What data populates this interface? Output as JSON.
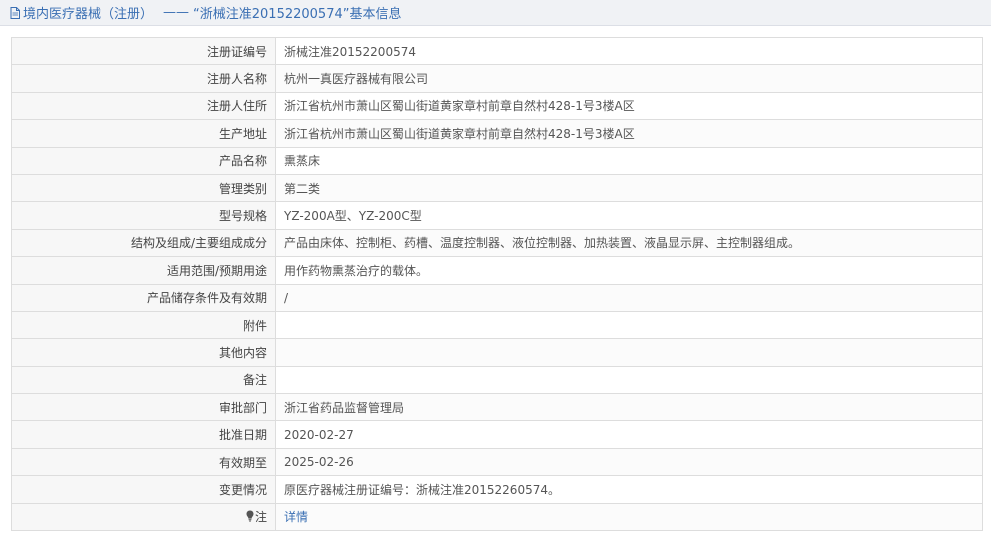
{
  "header": {
    "icon": "document-icon",
    "category": "境内医疗器械（注册）",
    "separator": "——",
    "title": "“浙械注准20152200574”基本信息"
  },
  "rows": [
    {
      "label": "注册证编号",
      "value": "浙械注准20152200574"
    },
    {
      "label": "注册人名称",
      "value": "杭州一真医疗器械有限公司"
    },
    {
      "label": "注册人住所",
      "value": "浙江省杭州市萧山区蜀山街道黄家章村前章自然村428-1号3楼A区"
    },
    {
      "label": "生产地址",
      "value": "浙江省杭州市萧山区蜀山街道黄家章村前章自然村428-1号3楼A区"
    },
    {
      "label": "产品名称",
      "value": "熏蒸床"
    },
    {
      "label": "管理类别",
      "value": "第二类"
    },
    {
      "label": "型号规格",
      "value": "YZ-200A型、YZ-200C型"
    },
    {
      "label": "结构及组成/主要组成成分",
      "value": "产品由床体、控制柜、药槽、温度控制器、液位控制器、加热装置、液晶显示屏、主控制器组成。"
    },
    {
      "label": "适用范围/预期用途",
      "value": "用作药物熏蒸治疗的载体。"
    },
    {
      "label": "产品储存条件及有效期",
      "value": "/"
    },
    {
      "label": "附件",
      "value": ""
    },
    {
      "label": "其他内容",
      "value": ""
    },
    {
      "label": "备注",
      "value": ""
    },
    {
      "label": "审批部门",
      "value": "浙江省药品监督管理局"
    },
    {
      "label": "批准日期",
      "value": "2020-02-27"
    },
    {
      "label": "有效期至",
      "value": "2025-02-26"
    },
    {
      "label": "变更情况",
      "value": "原医疗器械注册证编号：浙械注准20152260574。"
    }
  ],
  "note": {
    "icon": "lightbulb-icon",
    "label": "注",
    "link_text": "详情"
  },
  "colors": {
    "accent": "#3a6fb3",
    "header_bg": "#f0f2f5",
    "label_bg": "#f7f7f7",
    "border": "#dddddd"
  }
}
